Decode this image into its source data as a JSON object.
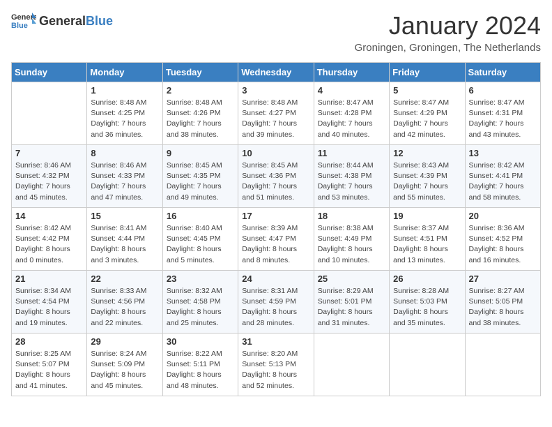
{
  "header": {
    "logo_general": "General",
    "logo_blue": "Blue",
    "month_title": "January 2024",
    "location": "Groningen, Groningen, The Netherlands"
  },
  "days_of_week": [
    "Sunday",
    "Monday",
    "Tuesday",
    "Wednesday",
    "Thursday",
    "Friday",
    "Saturday"
  ],
  "weeks": [
    [
      {
        "day": "",
        "sunrise": "",
        "sunset": "",
        "daylight": ""
      },
      {
        "day": "1",
        "sunrise": "Sunrise: 8:48 AM",
        "sunset": "Sunset: 4:25 PM",
        "daylight": "Daylight: 7 hours and 36 minutes."
      },
      {
        "day": "2",
        "sunrise": "Sunrise: 8:48 AM",
        "sunset": "Sunset: 4:26 PM",
        "daylight": "Daylight: 7 hours and 38 minutes."
      },
      {
        "day": "3",
        "sunrise": "Sunrise: 8:48 AM",
        "sunset": "Sunset: 4:27 PM",
        "daylight": "Daylight: 7 hours and 39 minutes."
      },
      {
        "day": "4",
        "sunrise": "Sunrise: 8:47 AM",
        "sunset": "Sunset: 4:28 PM",
        "daylight": "Daylight: 7 hours and 40 minutes."
      },
      {
        "day": "5",
        "sunrise": "Sunrise: 8:47 AM",
        "sunset": "Sunset: 4:29 PM",
        "daylight": "Daylight: 7 hours and 42 minutes."
      },
      {
        "day": "6",
        "sunrise": "Sunrise: 8:47 AM",
        "sunset": "Sunset: 4:31 PM",
        "daylight": "Daylight: 7 hours and 43 minutes."
      }
    ],
    [
      {
        "day": "7",
        "sunrise": "Sunrise: 8:46 AM",
        "sunset": "Sunset: 4:32 PM",
        "daylight": "Daylight: 7 hours and 45 minutes."
      },
      {
        "day": "8",
        "sunrise": "Sunrise: 8:46 AM",
        "sunset": "Sunset: 4:33 PM",
        "daylight": "Daylight: 7 hours and 47 minutes."
      },
      {
        "day": "9",
        "sunrise": "Sunrise: 8:45 AM",
        "sunset": "Sunset: 4:35 PM",
        "daylight": "Daylight: 7 hours and 49 minutes."
      },
      {
        "day": "10",
        "sunrise": "Sunrise: 8:45 AM",
        "sunset": "Sunset: 4:36 PM",
        "daylight": "Daylight: 7 hours and 51 minutes."
      },
      {
        "day": "11",
        "sunrise": "Sunrise: 8:44 AM",
        "sunset": "Sunset: 4:38 PM",
        "daylight": "Daylight: 7 hours and 53 minutes."
      },
      {
        "day": "12",
        "sunrise": "Sunrise: 8:43 AM",
        "sunset": "Sunset: 4:39 PM",
        "daylight": "Daylight: 7 hours and 55 minutes."
      },
      {
        "day": "13",
        "sunrise": "Sunrise: 8:42 AM",
        "sunset": "Sunset: 4:41 PM",
        "daylight": "Daylight: 7 hours and 58 minutes."
      }
    ],
    [
      {
        "day": "14",
        "sunrise": "Sunrise: 8:42 AM",
        "sunset": "Sunset: 4:42 PM",
        "daylight": "Daylight: 8 hours and 0 minutes."
      },
      {
        "day": "15",
        "sunrise": "Sunrise: 8:41 AM",
        "sunset": "Sunset: 4:44 PM",
        "daylight": "Daylight: 8 hours and 3 minutes."
      },
      {
        "day": "16",
        "sunrise": "Sunrise: 8:40 AM",
        "sunset": "Sunset: 4:45 PM",
        "daylight": "Daylight: 8 hours and 5 minutes."
      },
      {
        "day": "17",
        "sunrise": "Sunrise: 8:39 AM",
        "sunset": "Sunset: 4:47 PM",
        "daylight": "Daylight: 8 hours and 8 minutes."
      },
      {
        "day": "18",
        "sunrise": "Sunrise: 8:38 AM",
        "sunset": "Sunset: 4:49 PM",
        "daylight": "Daylight: 8 hours and 10 minutes."
      },
      {
        "day": "19",
        "sunrise": "Sunrise: 8:37 AM",
        "sunset": "Sunset: 4:51 PM",
        "daylight": "Daylight: 8 hours and 13 minutes."
      },
      {
        "day": "20",
        "sunrise": "Sunrise: 8:36 AM",
        "sunset": "Sunset: 4:52 PM",
        "daylight": "Daylight: 8 hours and 16 minutes."
      }
    ],
    [
      {
        "day": "21",
        "sunrise": "Sunrise: 8:34 AM",
        "sunset": "Sunset: 4:54 PM",
        "daylight": "Daylight: 8 hours and 19 minutes."
      },
      {
        "day": "22",
        "sunrise": "Sunrise: 8:33 AM",
        "sunset": "Sunset: 4:56 PM",
        "daylight": "Daylight: 8 hours and 22 minutes."
      },
      {
        "day": "23",
        "sunrise": "Sunrise: 8:32 AM",
        "sunset": "Sunset: 4:58 PM",
        "daylight": "Daylight: 8 hours and 25 minutes."
      },
      {
        "day": "24",
        "sunrise": "Sunrise: 8:31 AM",
        "sunset": "Sunset: 4:59 PM",
        "daylight": "Daylight: 8 hours and 28 minutes."
      },
      {
        "day": "25",
        "sunrise": "Sunrise: 8:29 AM",
        "sunset": "Sunset: 5:01 PM",
        "daylight": "Daylight: 8 hours and 31 minutes."
      },
      {
        "day": "26",
        "sunrise": "Sunrise: 8:28 AM",
        "sunset": "Sunset: 5:03 PM",
        "daylight": "Daylight: 8 hours and 35 minutes."
      },
      {
        "day": "27",
        "sunrise": "Sunrise: 8:27 AM",
        "sunset": "Sunset: 5:05 PM",
        "daylight": "Daylight: 8 hours and 38 minutes."
      }
    ],
    [
      {
        "day": "28",
        "sunrise": "Sunrise: 8:25 AM",
        "sunset": "Sunset: 5:07 PM",
        "daylight": "Daylight: 8 hours and 41 minutes."
      },
      {
        "day": "29",
        "sunrise": "Sunrise: 8:24 AM",
        "sunset": "Sunset: 5:09 PM",
        "daylight": "Daylight: 8 hours and 45 minutes."
      },
      {
        "day": "30",
        "sunrise": "Sunrise: 8:22 AM",
        "sunset": "Sunset: 5:11 PM",
        "daylight": "Daylight: 8 hours and 48 minutes."
      },
      {
        "day": "31",
        "sunrise": "Sunrise: 8:20 AM",
        "sunset": "Sunset: 5:13 PM",
        "daylight": "Daylight: 8 hours and 52 minutes."
      },
      {
        "day": "",
        "sunrise": "",
        "sunset": "",
        "daylight": ""
      },
      {
        "day": "",
        "sunrise": "",
        "sunset": "",
        "daylight": ""
      },
      {
        "day": "",
        "sunrise": "",
        "sunset": "",
        "daylight": ""
      }
    ]
  ]
}
